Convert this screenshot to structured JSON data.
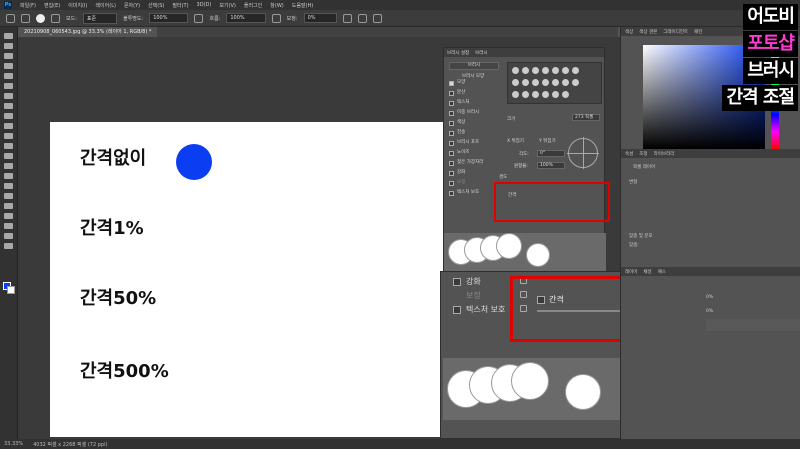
{
  "menubar": {
    "items": [
      "파일(F)",
      "편집(E)",
      "이미지(I)",
      "레이어(L)",
      "문자(Y)",
      "선택(S)",
      "필터(T)",
      "3D(D)",
      "보기(V)",
      "플러그인",
      "창(W)",
      "도움말(H)"
    ]
  },
  "options": {
    "mode_label": "모드:",
    "mode_value": "표준",
    "opacity_label": "불투명도:",
    "opacity_value": "100%",
    "flow_label": "흐름:",
    "flow_value": "100%",
    "smoothing_label": "보정:",
    "smoothing_value": "0%"
  },
  "document": {
    "tab_title": "20210908_060543.jpg @ 33.3% (레이어 1, RGB/8) *"
  },
  "canvas": {
    "rows": [
      "간격없이",
      "간격1%",
      "간격50%",
      "간격500%"
    ],
    "brush_color": "#0b3df2"
  },
  "brush_panel": {
    "tabs": [
      "브러시 설정",
      "브러시"
    ],
    "preset_button": "브러시",
    "list_header": "브러시 모양",
    "items": [
      {
        "label": "모양",
        "checked": true
      },
      {
        "label": "분산",
        "checked": false
      },
      {
        "label": "텍스처",
        "checked": false
      },
      {
        "label": "이중 브러시",
        "checked": false
      },
      {
        "label": "색상",
        "checked": false
      },
      {
        "label": "전송",
        "checked": false
      },
      {
        "label": "브러시 포즈",
        "checked": false
      },
      {
        "label": "노이즈",
        "checked": false
      },
      {
        "label": "젖은 가장자리",
        "checked": false
      },
      {
        "label": "강화",
        "checked": false
      },
      {
        "label": "보정",
        "checked": false,
        "disabled": true
      },
      {
        "label": "텍스처 보호",
        "checked": false
      }
    ],
    "size_label": "크기",
    "size_value": "273 픽셀",
    "flip_x": "X 뒤집기",
    "flip_y": "Y 뒤집기",
    "angle_label": "각도:",
    "angle_value": "0°",
    "roundness_label": "원형율:",
    "roundness_value": "100%",
    "hardness_label": "경도",
    "spacing_label": "간격"
  },
  "zoom_panel": {
    "rows": [
      {
        "label": "강화",
        "disabled": false
      },
      {
        "label": "보정",
        "disabled": true
      },
      {
        "label": "텍스처 보호",
        "disabled": false
      }
    ],
    "spacing_label": "간격"
  },
  "right_panels": {
    "color_tabs": [
      "색상",
      "색상 견본",
      "그레이디언트",
      "패턴"
    ],
    "properties_tabs": [
      "속성",
      "조정",
      "라이브러리"
    ],
    "pixel_layer": "픽셀 레이어",
    "transform": "변형",
    "align": "맞춤 및 분포",
    "align_sub": "맞춤:",
    "layers_tabs": [
      "레이어",
      "채널",
      "패스"
    ],
    "opacity_readout": "0%"
  },
  "status": {
    "zoom": "33.33%",
    "doc_info": "4032 픽셀 x 2268 픽셀 (72 ppi)"
  },
  "overlay": {
    "line1": "어도비",
    "line2": "포토샵",
    "line3": "브러시",
    "line4": "간격 조절",
    "colors": {
      "white": "#ffffff",
      "pink": "#ff3bd4"
    }
  }
}
